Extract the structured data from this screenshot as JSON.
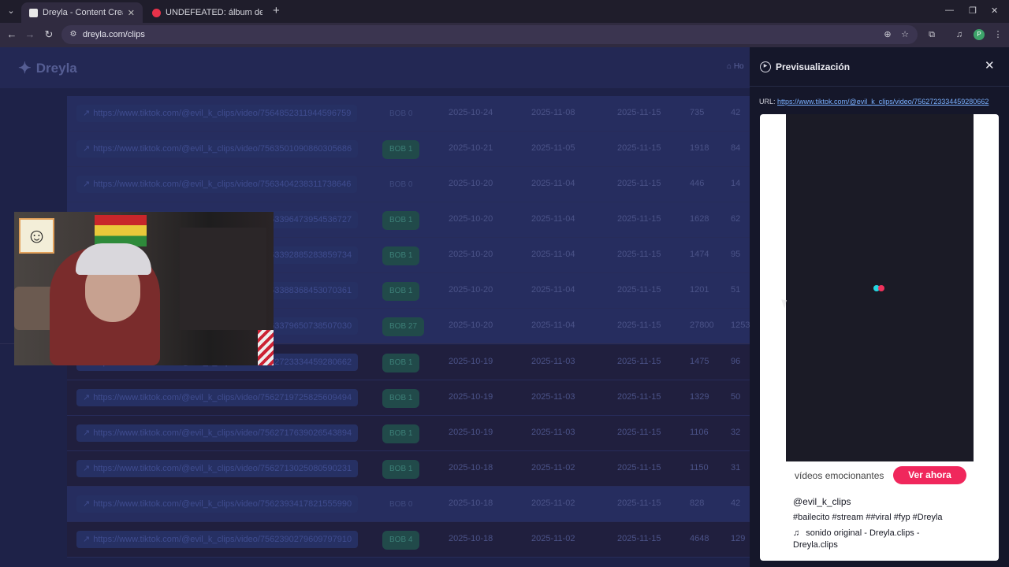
{
  "browser": {
    "tabs": [
      {
        "title": "Dreyla - Content Creator & Stre",
        "active": true,
        "favicon_color": "#e8e8e8"
      },
      {
        "title": "UNDEFEATED: álbum de XG",
        "active": false,
        "favicon_color": "#e8324a"
      }
    ],
    "url": "dreyla.com/clips",
    "icons": {
      "tab_search": "chevron-down-icon",
      "new_tab": "plus-icon",
      "back": "arrow-left-icon",
      "forward": "arrow-right-icon",
      "reload": "reload-icon",
      "site_info": "tune-icon",
      "zoom": "zoom-icon",
      "bookmark": "star-icon",
      "extensions": "puzzle-icon",
      "media": "media-icon",
      "menu": "kebab-icon"
    },
    "profile_initial": "P",
    "profile_color": "#3da36a"
  },
  "app": {
    "logo_text": "Dreyla",
    "home_link": "Ho",
    "rows": [
      {
        "url": "https://www.tiktok.com/@evil_k_clips/video/7564852311944596759",
        "badge": "BOB 0",
        "badge_on": false,
        "d1": "2025-10-24",
        "d2": "2025-11-08",
        "d3": "2025-11-15",
        "views": "735",
        "n": "42",
        "style": "hl"
      },
      {
        "url": "https://www.tiktok.com/@evil_k_clips/video/7563501090860305686",
        "badge": "BOB 1",
        "badge_on": true,
        "d1": "2025-10-21",
        "d2": "2025-11-05",
        "d3": "2025-11-15",
        "views": "1918",
        "n": "84",
        "style": "hl"
      },
      {
        "url": "https://www.tiktok.com/@evil_k_clips/video/7563404238311738646",
        "badge": "BOB 0",
        "badge_on": false,
        "d1": "2025-10-20",
        "d2": "2025-11-04",
        "d3": "2025-11-15",
        "views": "446",
        "n": "14",
        "style": "hl"
      },
      {
        "url": "https://www.tiktok.com/@evil_k_clips/video/7563396473954536727",
        "badge": "BOB 1",
        "badge_on": true,
        "d1": "2025-10-20",
        "d2": "2025-11-04",
        "d3": "2025-11-15",
        "views": "1628",
        "n": "62",
        "style": "hl"
      },
      {
        "url": "https://www.tiktok.com/@evil_k_clips/video/7563392885283859734",
        "badge": "BOB 1",
        "badge_on": true,
        "d1": "2025-10-20",
        "d2": "2025-11-04",
        "d3": "2025-11-15",
        "views": "1474",
        "n": "95",
        "style": "hl"
      },
      {
        "url": "https://www.tiktok.com/@evil_k_clips/video/7563388368453070361",
        "badge": "BOB 1",
        "badge_on": true,
        "d1": "2025-10-20",
        "d2": "2025-11-04",
        "d3": "2025-11-15",
        "views": "1201",
        "n": "51",
        "style": "hl"
      },
      {
        "url": "https://www.tiktok.com/@evil_k_clips/video/7563379650738507030",
        "badge": "BOB 27",
        "badge_on": true,
        "d1": "2025-10-20",
        "d2": "2025-11-04",
        "d3": "2025-11-15",
        "views": "27800",
        "n": "1253",
        "style": "hl"
      },
      {
        "url": "https://www.tiktok.com/@evil_k_clips/video/7562723334459280662",
        "badge": "BOB 1",
        "badge_on": true,
        "d1": "2025-10-19",
        "d2": "2025-11-03",
        "d3": "2025-11-15",
        "views": "1475",
        "n": "96",
        "style": "dark"
      },
      {
        "url": "https://www.tiktok.com/@evil_k_clips/video/7562719725825609494",
        "badge": "BOB 1",
        "badge_on": true,
        "d1": "2025-10-19",
        "d2": "2025-11-03",
        "d3": "2025-11-15",
        "views": "1329",
        "n": "50",
        "style": "dark"
      },
      {
        "url": "https://www.tiktok.com/@evil_k_clips/video/7562717639026543894",
        "badge": "BOB 1",
        "badge_on": true,
        "d1": "2025-10-19",
        "d2": "2025-11-03",
        "d3": "2025-11-15",
        "views": "1106",
        "n": "32",
        "style": "dark"
      },
      {
        "url": "https://www.tiktok.com/@evil_k_clips/video/7562713025080590231",
        "badge": "BOB 1",
        "badge_on": true,
        "d1": "2025-10-18",
        "d2": "2025-11-02",
        "d3": "2025-11-15",
        "views": "1150",
        "n": "31",
        "style": "dark"
      },
      {
        "url": "https://www.tiktok.com/@evil_k_clips/video/7562393417821555990",
        "badge": "BOB 0",
        "badge_on": false,
        "d1": "2025-10-18",
        "d2": "2025-11-02",
        "d3": "2025-11-15",
        "views": "828",
        "n": "42",
        "style": "dark-hl"
      },
      {
        "url": "https://www.tiktok.com/@evil_k_clips/video/7562390279609797910",
        "badge": "BOB 4",
        "badge_on": true,
        "d1": "2025-10-18",
        "d2": "2025-11-02",
        "d3": "2025-11-15",
        "views": "4648",
        "n": "129",
        "style": "dark"
      }
    ]
  },
  "panel": {
    "title": "Previsualización",
    "url_label": "URL:",
    "url": "https://www.tiktok.com/@evil_k_clips/video/7562723334459280662",
    "embed": {
      "promo_text": "vídeos emocionantes",
      "cta": "Ver ahora",
      "author": "@evil_k_clips",
      "hashtags": "#bailecito #stream ##viral #fyp #Dreyla",
      "sound_icon": "music-note-icon",
      "sound": "sonido original - Dreyla.clips - Dreyla.clips"
    }
  },
  "webcam": {
    "sticker_icon": "ghost-sticker-icon"
  }
}
